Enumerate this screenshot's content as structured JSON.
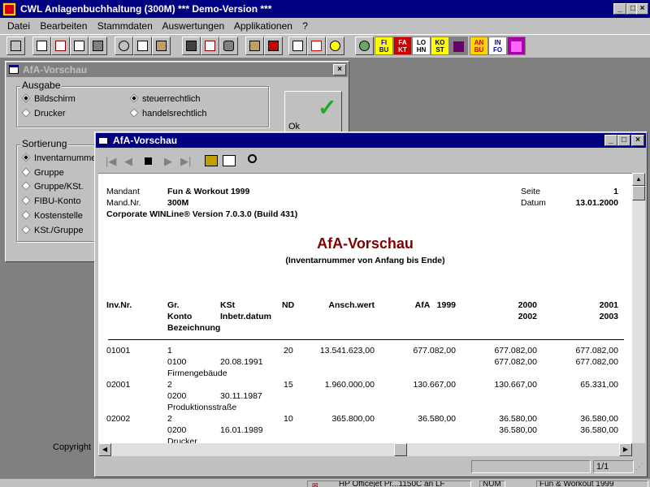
{
  "app": {
    "title": "CWL Anlagenbuchhaltung (300M) *** Demo-Version ***",
    "menu": [
      "Datei",
      "Bearbeiten",
      "Stammdaten",
      "Auswertungen",
      "Applikationen",
      "?"
    ],
    "toolbar_labels": [
      [
        "FI",
        "BU"
      ],
      [
        "FA",
        "KT"
      ],
      [
        "LO",
        "HN"
      ],
      [
        "KO",
        "ST"
      ],
      [
        "",
        ""
      ],
      [
        "AN",
        "BU"
      ],
      [
        "IN",
        "FO"
      ],
      [
        "",
        ""
      ]
    ]
  },
  "bg_dialog": {
    "title": "AfA-Vorschau",
    "ausgabe_label": "Ausgabe",
    "ausgabe_options": [
      "Bildschirm",
      "Drucker"
    ],
    "recht_options": [
      "steuerrechtlich",
      "handelsrechtlich"
    ],
    "ok_label": "Ok",
    "sortierung_label": "Sortierung",
    "sort_options": [
      "Inventarnumme",
      "Gruppe",
      "Gruppe/KSt.",
      "FIBU-Konto",
      "Kostenstelle",
      "KSt./Gruppe"
    ],
    "copyright": "Copyright"
  },
  "preview": {
    "title": "AfA-Vorschau",
    "page_indicator": "1/1"
  },
  "report": {
    "mandant_label": "Mandant",
    "mandant_value": "Fun & Workout 1999",
    "mandnr_label": "Mand.Nr.",
    "mandnr_value": "300M",
    "version": "Corporate WINLine® Version 7.0.3.0 (Build 431)",
    "seite_label": "Seite",
    "seite_value": "1",
    "datum_label": "Datum",
    "datum_value": "13.01.2000",
    "title": "AfA-Vorschau",
    "subtitle": "(Inventarnummer von Anfang bis Ende)",
    "headers": {
      "invnr": "Inv.Nr.",
      "gr": "Gr.",
      "konto": "Konto",
      "bez": "Bezeichnung",
      "kst": "KSt",
      "inbetr": "Inbetr.datum",
      "nd": "ND",
      "anschwert": "Ansch.wert",
      "afa": "AfA   1999",
      "y2000": "2000",
      "y2002": "2002",
      "y2001": "2001",
      "y2003": "2003"
    },
    "rows": [
      {
        "inv": "01001",
        "gr": "1",
        "nd": "20",
        "ansch": "13.541.623,00",
        "afa": "677.082,00",
        "c2000": "677.082,00",
        "c2001": "677.082,00",
        "konto": "0100",
        "datum": "20.08.1991",
        "c2002": "677.082,00",
        "c2003": "677.082,00",
        "bez": "Firmengebäude"
      },
      {
        "inv": "02001",
        "gr": "2",
        "nd": "15",
        "ansch": "1.960.000,00",
        "afa": "130.667,00",
        "c2000": "130.667,00",
        "c2001": "65.331,00",
        "konto": "0200",
        "datum": "30.11.1987",
        "c2002": "",
        "c2003": "",
        "bez": "Produktionsstraße"
      },
      {
        "inv": "02002",
        "gr": "2",
        "nd": "10",
        "ansch": "365.800,00",
        "afa": "36.580,00",
        "c2000": "36.580,00",
        "c2001": "36.580,00",
        "konto": "0200",
        "datum": "16.01.1989",
        "c2002": "36.580,00",
        "c2003": "36.580,00",
        "bez": "Drucker"
      }
    ]
  },
  "statusbar": {
    "fragment1": "HP Officejet Pr...1150C an LF",
    "fragment2": "NUM",
    "fragment3": "Fun & Workout 1999"
  }
}
